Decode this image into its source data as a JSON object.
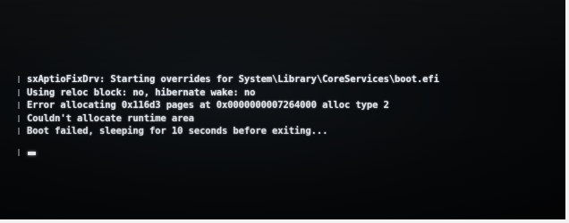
{
  "console": {
    "lines": [
      "sxAptioFixDrv: Starting overrides for System\\Library\\CoreServices\\boot.efi",
      "Using reloc block: no, hibernate wake: no",
      "Error allocating 0x116d3 pages at 0x0000000007264000 alloc type 2",
      "Couldn't allocate runtime area",
      "Boot failed, sleeping for 10 seconds before exiting..."
    ]
  },
  "colors": {
    "background": "#07090b",
    "text": "#e4e8ec"
  }
}
